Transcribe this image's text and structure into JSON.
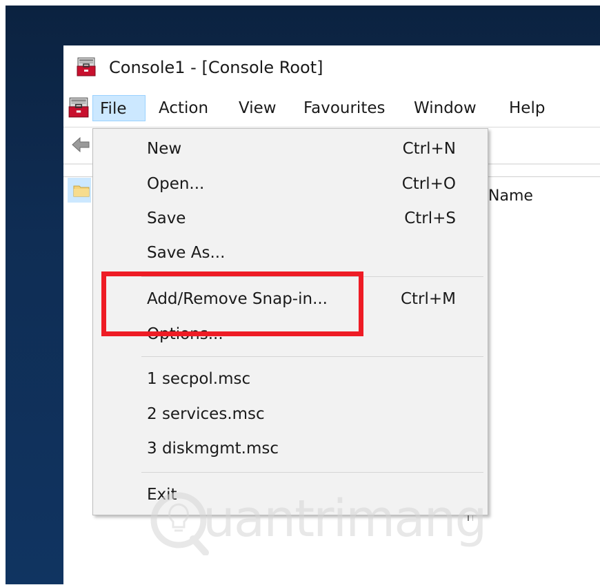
{
  "window": {
    "title": "Console1 - [Console Root]"
  },
  "menubar": {
    "items": [
      {
        "label": "File",
        "active": true
      },
      {
        "label": "Action"
      },
      {
        "label": "View"
      },
      {
        "label": "Favourites"
      },
      {
        "label": "Window"
      },
      {
        "label": "Help"
      }
    ]
  },
  "result_pane": {
    "column_header": "Name"
  },
  "file_menu": {
    "items": [
      {
        "label": "New",
        "shortcut": "Ctrl+N"
      },
      {
        "label": "Open...",
        "shortcut": "Ctrl+O"
      },
      {
        "label": "Save",
        "shortcut": "Ctrl+S"
      },
      {
        "label": "Save As...",
        "shortcut": ""
      },
      {
        "label": "Add/Remove Snap-in...",
        "shortcut": "Ctrl+M"
      },
      {
        "label": "Options...",
        "shortcut": ""
      },
      {
        "label": "1 secpol.msc",
        "shortcut": ""
      },
      {
        "label": "2 services.msc",
        "shortcut": ""
      },
      {
        "label": "3 diskmgmt.msc",
        "shortcut": ""
      },
      {
        "label": "Exit",
        "shortcut": ""
      }
    ]
  },
  "watermark": {
    "text": "uantrimang"
  },
  "colors": {
    "desktop": "#0f2d54",
    "highlight": "#ee1c25",
    "menu_active": "#cce8ff",
    "dropdown_bg": "#f2f2f2"
  },
  "icons": {
    "app": "mmc-toolbox-icon",
    "back": "back-arrow-icon",
    "folder": "folder-icon"
  }
}
